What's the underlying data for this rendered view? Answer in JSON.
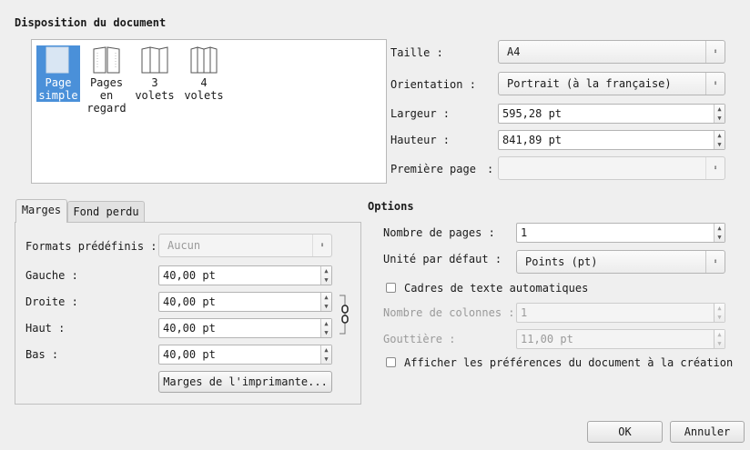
{
  "header": {
    "title": "Disposition du document"
  },
  "layouts": [
    {
      "label": "Page\nsimple",
      "icon": "single-page-icon",
      "selected": true
    },
    {
      "label": "Pages\nen\nregard",
      "icon": "facing-pages-icon",
      "selected": false
    },
    {
      "label": "3\nvolets",
      "icon": "three-fold-icon",
      "selected": false
    },
    {
      "label": "4\nvolets",
      "icon": "four-fold-icon",
      "selected": false
    }
  ],
  "page": {
    "size_label": "Taille :",
    "size_value": "A4",
    "orientation_label": "Orientation :",
    "orientation_value": "Portrait (à la française)",
    "width_label": "Largeur :",
    "width_value": "595,28 pt",
    "height_label": "Hauteur :",
    "height_value": "841,89 pt",
    "first_page_label": "Première page",
    "first_page_colon": ":",
    "first_page_value": ""
  },
  "tabs": [
    {
      "label": "Marges",
      "active": true
    },
    {
      "label": "Fond perdu",
      "active": false
    }
  ],
  "margins": {
    "presets_label": "Formats prédéfinis :",
    "presets_value": "Aucun",
    "left_label": "Gauche :",
    "left_value": "40,00 pt",
    "right_label": "Droite :",
    "right_value": "40,00 pt",
    "top_label": "Haut :",
    "top_value": "40,00 pt",
    "bottom_label": "Bas :",
    "bottom_value": "40,00 pt",
    "printer_button": "Marges de l'imprimante..."
  },
  "options": {
    "title": "Options",
    "pages_label": "Nombre de pages :",
    "pages_value": "1",
    "unit_label": "Unité par défaut :",
    "unit_value": "Points (pt)",
    "auto_frames_label": "Cadres de texte automatiques",
    "auto_frames_checked": false,
    "columns_label": "Nombre de colonnes :",
    "columns_value": "1",
    "gutter_label": "Gouttière :",
    "gutter_value": "11,00 pt",
    "show_prefs_label": "Afficher les préférences du document à la création",
    "show_prefs_checked": false
  },
  "footer": {
    "ok_label": "OK",
    "cancel_label": "Annuler"
  },
  "colors": {
    "selection": "#4a90d9",
    "background": "#efefef"
  }
}
